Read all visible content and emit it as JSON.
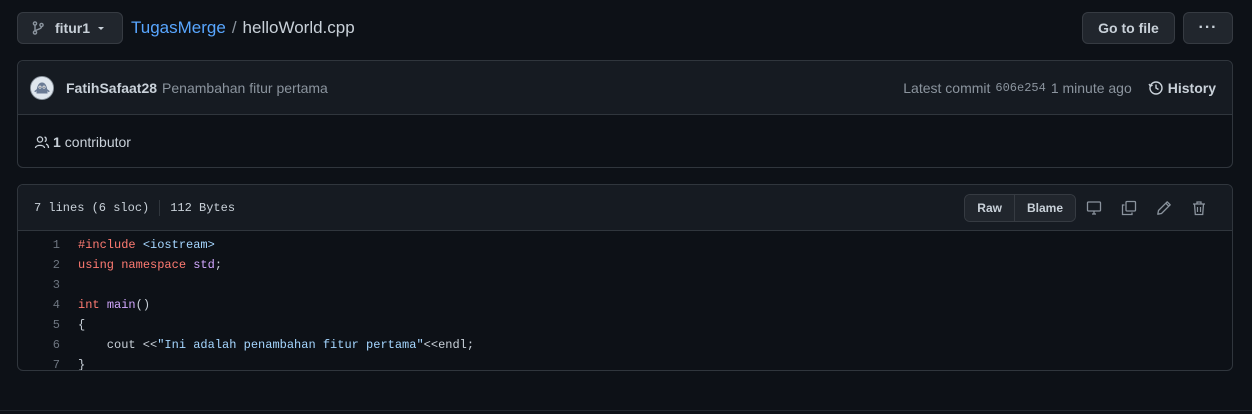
{
  "branch": {
    "name": "fitur1"
  },
  "breadcrumb": {
    "repo": "TugasMerge",
    "separator": "/",
    "file": "helloWorld.cpp"
  },
  "toolbar": {
    "goto_file": "Go to file",
    "more": "···"
  },
  "commit": {
    "author": "FatihSafaat28",
    "message": "Penambahan fitur pertama",
    "latest_label": "Latest commit",
    "sha": "606e254",
    "time": "1 minute ago",
    "history_label": "History"
  },
  "contributors": {
    "count": "1",
    "label": "contributor"
  },
  "file": {
    "lines_info": "7 lines (6 sloc)",
    "size": "112 Bytes",
    "raw_label": "Raw",
    "blame_label": "Blame"
  },
  "code": {
    "lines": [
      {
        "num": "1",
        "tokens": [
          {
            "t": "#include",
            "c": "k"
          },
          {
            "t": " ",
            "c": "n"
          },
          {
            "t": "<iostream>",
            "c": "s"
          }
        ]
      },
      {
        "num": "2",
        "tokens": [
          {
            "t": "using",
            "c": "k"
          },
          {
            "t": " ",
            "c": "n"
          },
          {
            "t": "namespace",
            "c": "k"
          },
          {
            "t": " ",
            "c": "n"
          },
          {
            "t": "std",
            "c": "f"
          },
          {
            "t": ";",
            "c": "n"
          }
        ]
      },
      {
        "num": "3",
        "tokens": []
      },
      {
        "num": "4",
        "tokens": [
          {
            "t": "int",
            "c": "k"
          },
          {
            "t": " ",
            "c": "n"
          },
          {
            "t": "main",
            "c": "f"
          },
          {
            "t": "()",
            "c": "n"
          }
        ]
      },
      {
        "num": "5",
        "tokens": [
          {
            "t": "{",
            "c": "n"
          }
        ]
      },
      {
        "num": "6",
        "tokens": [
          {
            "t": "    cout <<",
            "c": "n"
          },
          {
            "t": "\"Ini adalah penambahan fitur pertama\"",
            "c": "s"
          },
          {
            "t": "<<endl;",
            "c": "n"
          }
        ]
      },
      {
        "num": "7",
        "tokens": [
          {
            "t": "}",
            "c": "n"
          }
        ]
      }
    ]
  },
  "icons": {
    "branch": "git-branch-icon",
    "caret": "chevron-down-icon",
    "history": "history-icon",
    "people": "people-icon",
    "display": "display-icon",
    "copy": "copy-icon",
    "edit": "pencil-icon",
    "delete": "trash-icon"
  },
  "colors": {
    "background": "#0d1117",
    "panel": "#161b22",
    "border": "#30363d",
    "link": "#58a6ff",
    "keyword": "#ff7b72",
    "string": "#a5d6ff",
    "entity": "#d2a8ff"
  }
}
